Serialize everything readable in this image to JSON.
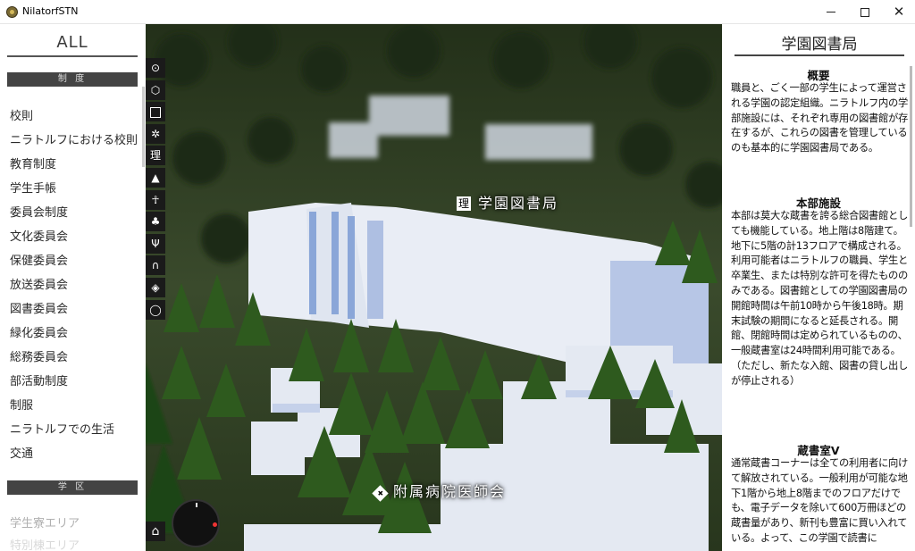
{
  "window": {
    "title": "NilatorfSTN"
  },
  "sidebar": {
    "title": "ALL",
    "sections": [
      {
        "label": "制 度",
        "items": [
          "校則",
          "ニラトルフにおける校則",
          "教育制度",
          "学生手帳",
          "委員会制度",
          "文化委員会",
          "保健委員会",
          "放送委員会",
          "図書委員会",
          "緑化委員会",
          "総務委員会",
          "部活動制度",
          "制服",
          "ニラトルフでの生活",
          "交通"
        ]
      },
      {
        "label": "学 区",
        "items": [
          "学生寮エリア",
          "特別棟エリア"
        ]
      }
    ]
  },
  "map": {
    "tools": [
      "search-icon",
      "cube-icon",
      "district-icon",
      "flower-icon",
      "science-icon",
      "mountain-icon",
      "person-icon",
      "tree-icon",
      "restaurant-icon",
      "tunnel-icon",
      "medical-icon",
      "ring-icon"
    ],
    "labels": {
      "library": "学園図書局",
      "library_icon": "理",
      "medical": "附属病院医師会",
      "medical_icon": "✚"
    },
    "home_icon": "home-icon",
    "compass_icon": "compass-icon"
  },
  "panel": {
    "title": "学園図書局",
    "sections": [
      {
        "heading": "概要",
        "body": "職員と、ごく一部の学生によって運営される学園の認定組織。ニラトルフ内の学部施設には、それぞれ専用の図書館が存在するが、これらの図書を管理しているのも基本的に学園図書局である。"
      },
      {
        "heading": "本部施設",
        "body": "本部は莫大な蔵書を誇る総合図書館としても機能している。地上階は8階建て。地下に5階の計13フロアで構成される。利用可能者はニラトルフの職員、学生と卒業生、または特別な許可を得たもののみである。図書館としての学園図書局の開館時間は午前10時から午後18時。期末試験の期間になると延長される。開館、閉館時間は定められているものの、一般蔵書室は24時間利用可能である。（ただし、新たな入館、図書の貸し出しが停止される）"
      },
      {
        "heading": "蔵書室Ⅴ",
        "body": "通常蔵書コーナーは全ての利用者に向けて解放されている。一般利用が可能な地下1階から地上8階までのフロアだけでも、電子データを除いて600万冊ほどの蔵書量があり、新刊も豊富に買い入れている。よって、この学園で読書に"
      }
    ]
  },
  "colors": {
    "accent": "#444444",
    "map_bg": "#2d3a22",
    "building": "#eef2f8"
  }
}
